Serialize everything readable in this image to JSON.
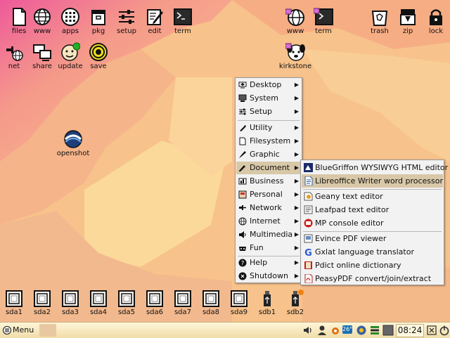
{
  "desktop": {
    "top_icons_left": [
      {
        "label": "files",
        "icon": "file-icon"
      },
      {
        "label": "www",
        "icon": "globe-icon"
      },
      {
        "label": "apps",
        "icon": "apps-grid-icon"
      },
      {
        "label": "pkg",
        "icon": "package-icon"
      },
      {
        "label": "setup",
        "icon": "sliders-icon"
      },
      {
        "label": "edit",
        "icon": "edit-icon"
      },
      {
        "label": "term",
        "icon": "terminal-icon"
      }
    ],
    "second_row_icons": [
      {
        "label": "net",
        "icon": "network-icon"
      },
      {
        "label": "share",
        "icon": "share-icon"
      },
      {
        "label": "update",
        "icon": "update-icon"
      },
      {
        "label": "save",
        "icon": "save-target-icon"
      }
    ],
    "top_icons_mid": [
      {
        "label": "www",
        "icon": "globe-lock-icon"
      },
      {
        "label": "term",
        "icon": "terminal-lock-icon"
      }
    ],
    "top_icons_right": [
      {
        "label": "trash",
        "icon": "trash-icon"
      },
      {
        "label": "zip",
        "icon": "zip-icon"
      },
      {
        "label": "lock",
        "icon": "lock-icon"
      }
    ],
    "kirkstone": {
      "label": "kirkstone",
      "icon": "dog-face-icon"
    },
    "openshot": {
      "label": "openshot",
      "icon": "openshot-icon"
    },
    "drives": [
      "sda1",
      "sda2",
      "sda3",
      "sda4",
      "sda5",
      "sda6",
      "sda7",
      "sda8",
      "sda9",
      "sdb1",
      "sdb2"
    ]
  },
  "menu": {
    "items": [
      {
        "label": "Desktop",
        "icon": "desktop-icon"
      },
      {
        "label": "System",
        "icon": "system-icon"
      },
      {
        "label": "Setup",
        "icon": "setup-icon"
      },
      {
        "label": "Utility",
        "icon": "utility-icon"
      },
      {
        "label": "Filesystem",
        "icon": "filesystem-icon"
      },
      {
        "label": "Graphic",
        "icon": "graphic-icon"
      },
      {
        "label": "Document",
        "icon": "document-icon"
      },
      {
        "label": "Business",
        "icon": "business-icon"
      },
      {
        "label": "Personal",
        "icon": "personal-icon"
      },
      {
        "label": "Network",
        "icon": "network-icon"
      },
      {
        "label": "Internet",
        "icon": "internet-icon"
      },
      {
        "label": "Multimedia",
        "icon": "multimedia-icon"
      },
      {
        "label": "Fun",
        "icon": "fun-icon"
      },
      {
        "label": "Help",
        "icon": "help-icon"
      },
      {
        "label": "Shutdown",
        "icon": "shutdown-icon"
      }
    ],
    "highlighted": "Document"
  },
  "submenu": {
    "items": [
      {
        "label": "BlueGriffon WYSIWYG HTML editor",
        "icon": "bluegriffon-icon"
      },
      {
        "label": "Libreoffice Writer word processor",
        "icon": "writer-icon"
      },
      {
        "label": "Geany text editor",
        "icon": "geany-icon"
      },
      {
        "label": "Leafpad text editor",
        "icon": "leafpad-icon"
      },
      {
        "label": "MP console editor",
        "icon": "mp-icon"
      },
      {
        "label": "Evince PDF viewer",
        "icon": "evince-icon"
      },
      {
        "label": "Gxlat language translator",
        "icon": "gxlat-icon"
      },
      {
        "label": "Pdict online dictionary",
        "icon": "pdict-icon"
      },
      {
        "label": "PeasyPDF convert/join/extract",
        "icon": "peasypdf-icon"
      }
    ],
    "highlighted": "Libreoffice Writer word processor"
  },
  "taskbar": {
    "menu_label": "Menu",
    "temperature": "26°",
    "clock": "08:24"
  },
  "colors": {
    "accent_highlight": "#d8c8a8",
    "taskbar": "#f0dca8"
  }
}
